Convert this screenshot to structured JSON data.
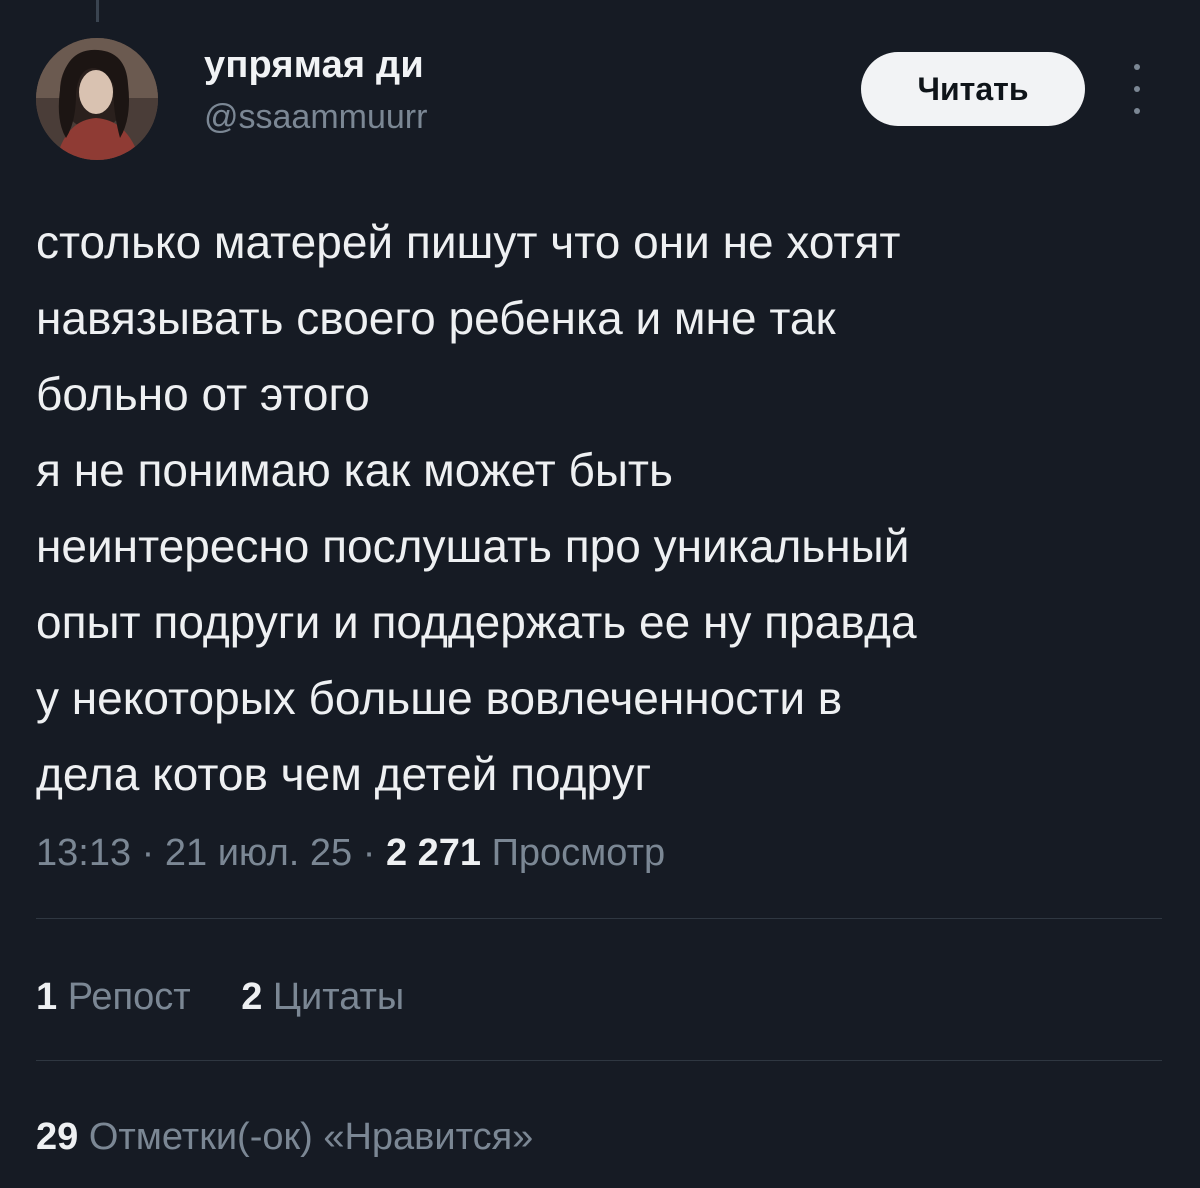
{
  "author": {
    "display_name": "упрямая ди",
    "handle": "@ssaammuurr"
  },
  "follow_button": {
    "label": "Читать"
  },
  "more_icon": "vertical-ellipsis-icon",
  "tweet": {
    "lines": [
      "столько матерей пишут что они не хотят",
      "навязывать своего ребенка и мне так",
      "больно от этого",
      "я не понимаю как может быть",
      "неинтересно послушать про уникальный",
      "опыт подруги и поддержать ее ну правда",
      "у некоторых больше вовлеченности в",
      "дела котов чем детей подруг"
    ]
  },
  "meta": {
    "time": "13:13",
    "separator": "·",
    "date": "21 июл. 25",
    "views_count": "2 271",
    "views_label": "Просмотр"
  },
  "stats": {
    "reposts": {
      "count": "1",
      "label": "Репост"
    },
    "quotes": {
      "count": "2",
      "label": "Цитаты"
    },
    "likes": {
      "count": "29",
      "label": "Отметки(-ок) «Нравится»"
    }
  },
  "colors": {
    "background": "#161b24",
    "text_primary": "#eef0f2",
    "text_secondary": "#7b8794",
    "button_bg": "#f2f3f5",
    "divider": "#2f3741"
  }
}
